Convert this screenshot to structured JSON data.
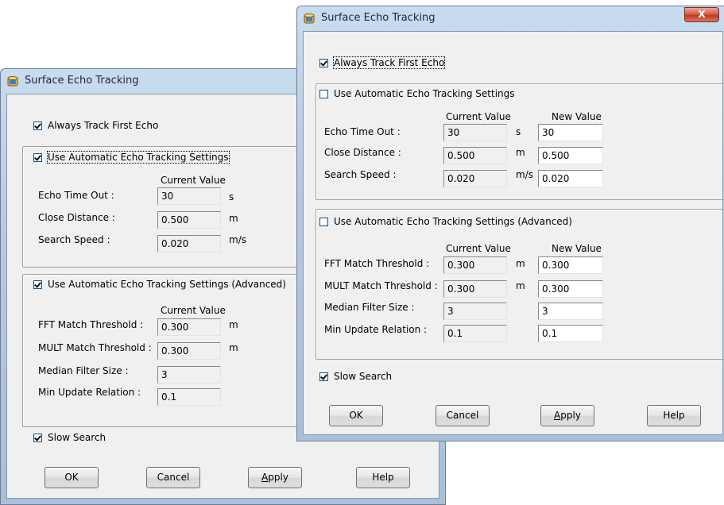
{
  "back_dialog": {
    "title": "Surface Echo Tracking",
    "always_track_first_echo": {
      "label": "Always Track First Echo",
      "checked": true
    },
    "auto_settings": {
      "label": "Use Automatic Echo Tracking Settings",
      "checked": true,
      "current_value_header": "Current Value",
      "rows": [
        {
          "label": "Echo Time Out :",
          "current": "30",
          "unit": "s"
        },
        {
          "label": "Close Distance :",
          "current": "0.500",
          "unit": "m"
        },
        {
          "label": "Search Speed :",
          "current": "0.020",
          "unit": "m/s"
        }
      ]
    },
    "advanced_settings": {
      "label": "Use Automatic Echo Tracking  Settings (Advanced)",
      "checked": true,
      "current_value_header": "Current Value",
      "rows": [
        {
          "label": "FFT Match Threshold :",
          "current": "0.300",
          "unit": "m"
        },
        {
          "label": "MULT Match Threshold :",
          "current": "0.300",
          "unit": "m"
        },
        {
          "label": "Median Filter Size :",
          "current": "3",
          "unit": ""
        },
        {
          "label": "Min Update Relation :",
          "current": "0.1",
          "unit": ""
        }
      ]
    },
    "slow_search": {
      "label": "Slow Search",
      "checked": true
    },
    "buttons": {
      "ok": "OK",
      "cancel": "Cancel",
      "apply_u": "A",
      "apply_rest": "pply",
      "help": "Help"
    }
  },
  "front_dialog": {
    "title": "Surface Echo Tracking",
    "close_glyph": "X",
    "always_track_first_echo": {
      "label": "Always Track First Echo",
      "checked": true
    },
    "auto_settings": {
      "label": "Use Automatic Echo Tracking Settings",
      "checked": false,
      "current_value_header": "Current Value",
      "new_value_header": "New Value",
      "rows": [
        {
          "label": "Echo Time Out :",
          "current": "30",
          "unit": "s",
          "new": "30"
        },
        {
          "label": "Close Distance :",
          "current": "0.500",
          "unit": "m",
          "new": "0.500"
        },
        {
          "label": "Search Speed :",
          "current": "0.020",
          "unit": "m/s",
          "new": "0.020"
        }
      ]
    },
    "advanced_settings": {
      "label": "Use Automatic Echo Tracking  Settings (Advanced)",
      "checked": false,
      "current_value_header": "Current Value",
      "new_value_header": "New Value",
      "rows": [
        {
          "label": "FFT Match Threshold :",
          "current": "0.300",
          "unit": "m",
          "new": "0.300"
        },
        {
          "label": "MULT Match Threshold :",
          "current": "0.300",
          "unit": "m",
          "new": "0.300"
        },
        {
          "label": "Median Filter Size :",
          "current": "3",
          "unit": "",
          "new": "3"
        },
        {
          "label": "Min Update Relation :",
          "current": "0.1",
          "unit": "",
          "new": "0.1"
        }
      ]
    },
    "slow_search": {
      "label": "Slow Search",
      "checked": true
    },
    "buttons": {
      "ok": "OK",
      "cancel": "Cancel",
      "apply_u": "A",
      "apply_rest": "pply",
      "help": "Help"
    }
  },
  "icons": {
    "title_icon": "database-icon",
    "close_icon": "close-icon"
  },
  "colors": {
    "titlebar": "#b3c9e2",
    "client": "#f0f0f0",
    "close_button": "#c13a1d"
  }
}
